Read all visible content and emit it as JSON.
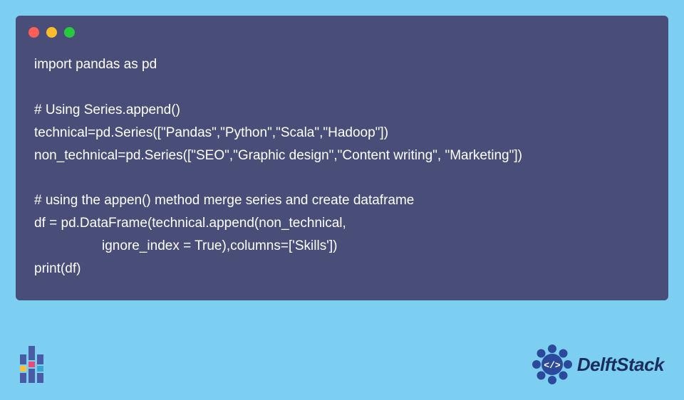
{
  "code": {
    "line1": "import pandas as pd",
    "line2": "",
    "line3": "# Using Series.append()",
    "line4": "technical=pd.Series([\"Pandas\",\"Python\",\"Scala\",\"Hadoop\"])",
    "line5": "non_technical=pd.Series([\"SEO\",\"Graphic design\",\"Content writing\", \"Marketing\"])",
    "line6": "",
    "line7": "# using the appen() method merge series and create dataframe",
    "line8": "df = pd.DataFrame(technical.append(non_technical,",
    "line9": "                  ignore_index = True),columns=['Skills'])",
    "line10": "print(df)"
  },
  "branding": {
    "right_name": "DelftStack"
  },
  "window": {
    "dot_red": "#ff5f56",
    "dot_yellow": "#ffbd2e",
    "dot_green": "#27c93f",
    "bg": "#494e78"
  }
}
